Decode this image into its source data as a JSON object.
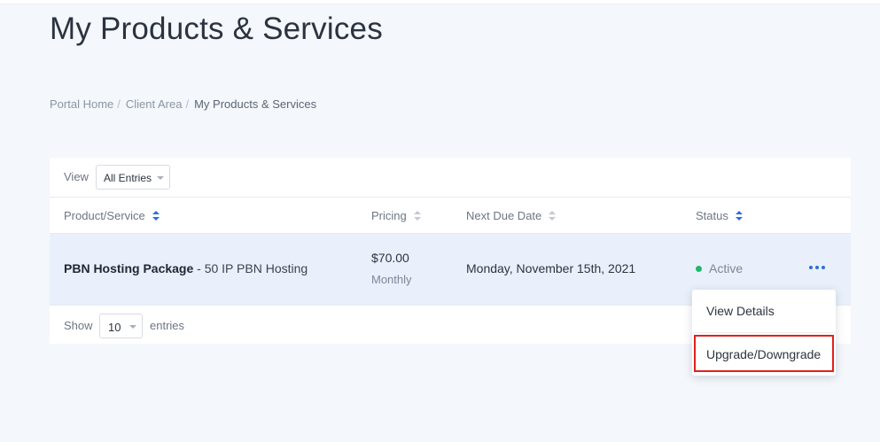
{
  "page": {
    "title": "My Products & Services"
  },
  "breadcrumb": [
    {
      "label": "Portal Home"
    },
    {
      "label": "Client Area"
    },
    {
      "label": "My Products & Services"
    }
  ],
  "breadcrumb_separator": "/",
  "toolbar": {
    "view_label": "View",
    "view_selected": "All Entries"
  },
  "table": {
    "columns": [
      "Product/Service",
      "Pricing",
      "Next Due Date",
      "Status"
    ],
    "rows": [
      {
        "product_name": "PBN Hosting Package",
        "product_detail": " - 50 IP PBN Hosting",
        "price": "$70.00",
        "cycle": "Monthly",
        "next_due": "Monday, November 15th, 2021",
        "status": "Active",
        "status_color": "#1fb96a"
      }
    ]
  },
  "footer": {
    "show_label": "Show",
    "page_size": "10",
    "entries_label": "entries"
  },
  "dropdown": {
    "items": [
      "View Details",
      "Upgrade/Downgrade"
    ],
    "highlight_color": "#e0211c"
  },
  "colors": {
    "accent": "#2f6fd6",
    "row_bg": "#e9f0fb",
    "page_bg": "#f4f7fb"
  }
}
